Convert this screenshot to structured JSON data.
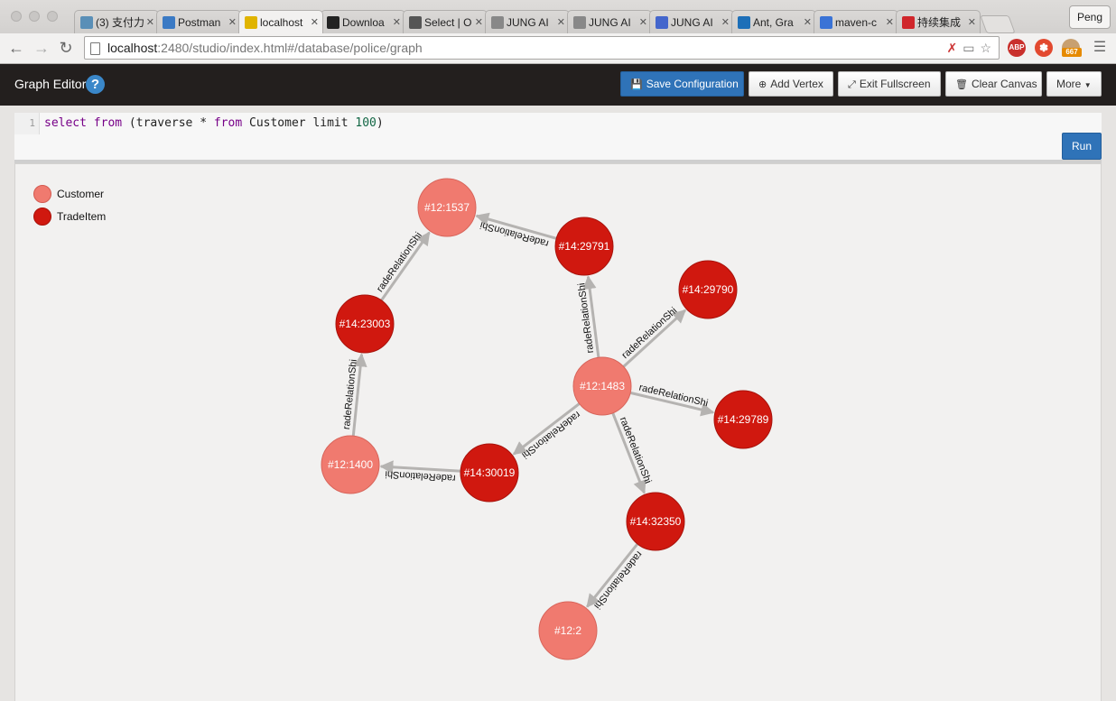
{
  "browser": {
    "tabs": [
      {
        "title": "(3) 支付力",
        "favicon": "stack-icon",
        "color": "#5a8fb7"
      },
      {
        "title": "Postman",
        "favicon": "globe-icon",
        "color": "#3b7ac4"
      },
      {
        "title": "localhost",
        "favicon": "star-icon",
        "color": "#e0b400",
        "active": true
      },
      {
        "title": "Downloa",
        "favicon": "github-icon",
        "color": "#222222"
      },
      {
        "title": "Select | O",
        "favicon": "book-icon",
        "color": "#555555"
      },
      {
        "title": "JUNG AI",
        "favicon": "page-icon",
        "color": "#888888"
      },
      {
        "title": "JUNG AI",
        "favicon": "page-icon",
        "color": "#888888"
      },
      {
        "title": "JUNG AI",
        "favicon": "jung-icon",
        "color": "#4466cc"
      },
      {
        "title": "Ant, Gra",
        "favicon": "drop-icon",
        "color": "#1d6fb8"
      },
      {
        "title": "maven-c",
        "favicon": "google-icon",
        "color": "#3a73d6"
      },
      {
        "title": "持续集成",
        "favicon": "c-icon",
        "color": "#d0262b"
      }
    ],
    "profile": "Peng",
    "url_host": "localhost",
    "url_rest": ":2480/studio/index.html#/database/police/graph",
    "ext_badge": "667",
    "abp_label": "ABP"
  },
  "app": {
    "title": "Graph Editor",
    "help": "?",
    "buttons": {
      "save": "Save Configuration",
      "add_vertex": "Add Vertex",
      "exit_fullscreen": "Exit Fullscreen",
      "clear_canvas": "Clear Canvas",
      "more": "More"
    }
  },
  "editor": {
    "line_number": "1",
    "kw_select": "select",
    "kw_from": "from",
    "paren_open": " (traverse * ",
    "kw_from2": "from",
    "tail": " Customer limit ",
    "limit": "100",
    "close": ")",
    "run": "Run"
  },
  "legend": [
    {
      "label": "Customer",
      "color": "#f07a6f",
      "border": "#d45a50"
    },
    {
      "label": "TradeItem",
      "color": "#d0180f",
      "border": "#a81008"
    }
  ],
  "graph": {
    "edge_label": "radeRelationShi",
    "colors": {
      "customer": "#f07a6f",
      "tradeitem": "#d0180f",
      "edge": "#b5b3b1"
    },
    "nodes": [
      {
        "id": "#12:1537",
        "type": "customer"
      },
      {
        "id": "#14:29791",
        "type": "tradeitem"
      },
      {
        "id": "#14:23003",
        "type": "tradeitem"
      },
      {
        "id": "#14:29790",
        "type": "tradeitem"
      },
      {
        "id": "#12:1483",
        "type": "customer"
      },
      {
        "id": "#14:29789",
        "type": "tradeitem"
      },
      {
        "id": "#12:1400",
        "type": "customer"
      },
      {
        "id": "#14:30019",
        "type": "tradeitem"
      },
      {
        "id": "#14:32350",
        "type": "tradeitem"
      },
      {
        "id": "#12:2",
        "type": "customer"
      }
    ],
    "edges": [
      {
        "from": "#14:29791",
        "to": "#12:1537"
      },
      {
        "from": "#14:23003",
        "to": "#12:1537"
      },
      {
        "from": "#12:1483",
        "to": "#14:29791"
      },
      {
        "from": "#12:1483",
        "to": "#14:29790"
      },
      {
        "from": "#12:1483",
        "to": "#14:29789"
      },
      {
        "from": "#12:1483",
        "to": "#14:30019"
      },
      {
        "from": "#12:1483",
        "to": "#14:32350"
      },
      {
        "from": "#14:30019",
        "to": "#12:1400"
      },
      {
        "from": "#12:1400",
        "to": "#14:23003"
      },
      {
        "from": "#14:32350",
        "to": "#12:2"
      }
    ]
  }
}
